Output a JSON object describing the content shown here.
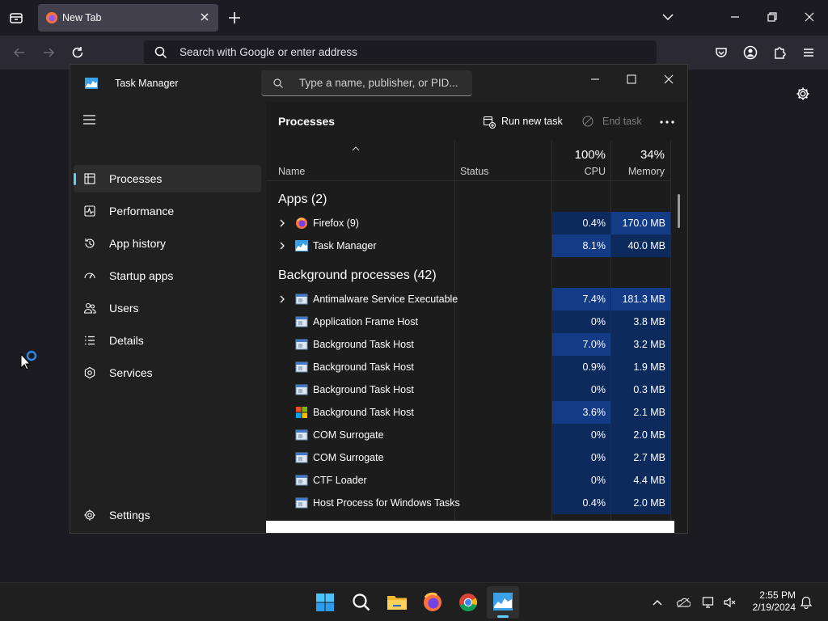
{
  "browser": {
    "tab_title": "New Tab",
    "url_placeholder": "Search with Google or enter address"
  },
  "task_manager": {
    "window_title": "Task Manager",
    "search_placeholder": "Type a name, publisher, or PID...",
    "sidebar": {
      "items": [
        {
          "label": "Processes",
          "icon": "processes-icon",
          "active": true
        },
        {
          "label": "Performance",
          "icon": "performance-icon"
        },
        {
          "label": "App history",
          "icon": "app-history-icon"
        },
        {
          "label": "Startup apps",
          "icon": "startup-apps-icon"
        },
        {
          "label": "Users",
          "icon": "users-icon"
        },
        {
          "label": "Details",
          "icon": "details-icon"
        },
        {
          "label": "Services",
          "icon": "services-icon"
        }
      ],
      "settings_label": "Settings"
    },
    "page_title": "Processes",
    "commands": {
      "run_new_task": "Run new task",
      "end_task": "End task"
    },
    "columns": {
      "name": "Name",
      "status": "Status",
      "cpu_total": "100%",
      "cpu": "CPU",
      "memory_total": "34%",
      "memory": "Memory"
    },
    "groups": {
      "apps": "Apps (2)",
      "background": "Background processes (42)"
    },
    "apps": [
      {
        "name": "Firefox (9)",
        "cpu": "0.4%",
        "memory": "170.0 MB",
        "expandable": true,
        "icon": "firefox-icon"
      },
      {
        "name": "Task Manager",
        "cpu": "8.1%",
        "memory": "40.0 MB",
        "expandable": true,
        "icon": "task-manager-icon"
      }
    ],
    "background": [
      {
        "name": "Antimalware Service Executable",
        "cpu": "7.4%",
        "memory": "181.3 MB",
        "expandable": true,
        "icon": "service-window-icon"
      },
      {
        "name": "Application Frame Host",
        "cpu": "0%",
        "memory": "3.8 MB",
        "expandable": false,
        "icon": "service-window-icon"
      },
      {
        "name": "Background Task Host",
        "cpu": "7.0%",
        "memory": "3.2 MB",
        "expandable": false,
        "icon": "service-window-icon"
      },
      {
        "name": "Background Task Host",
        "cpu": "0.9%",
        "memory": "1.9 MB",
        "expandable": false,
        "icon": "service-window-icon"
      },
      {
        "name": "Background Task Host",
        "cpu": "0%",
        "memory": "0.3 MB",
        "expandable": false,
        "icon": "service-window-icon"
      },
      {
        "name": "Background Task Host",
        "cpu": "3.6%",
        "memory": "2.1 MB",
        "expandable": false,
        "icon": "windows-logo-icon"
      },
      {
        "name": "COM Surrogate",
        "cpu": "0%",
        "memory": "2.0 MB",
        "expandable": false,
        "icon": "service-window-icon"
      },
      {
        "name": "COM Surrogate",
        "cpu": "0%",
        "memory": "2.7 MB",
        "expandable": false,
        "icon": "service-window-icon"
      },
      {
        "name": "CTF Loader",
        "cpu": "0%",
        "memory": "4.4 MB",
        "expandable": false,
        "icon": "service-window-icon"
      },
      {
        "name": "Host Process for Windows Tasks",
        "cpu": "0.4%",
        "memory": "2.0 MB",
        "expandable": false,
        "icon": "service-window-icon"
      }
    ]
  },
  "taskbar": {
    "time": "2:55 PM",
    "date": "2/19/2024",
    "pinned": [
      "start-icon",
      "search-icon",
      "file-explorer-icon",
      "firefox-icon",
      "chrome-icon",
      "task-manager-icon"
    ]
  },
  "colors": {
    "accent": "#60cdff",
    "heat_low": "#0c2a5c",
    "heat_high": "#143b86"
  }
}
